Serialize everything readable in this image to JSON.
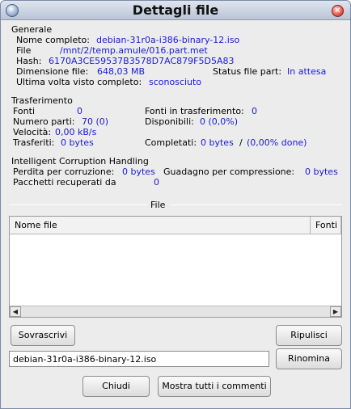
{
  "window": {
    "title": "Dettagli file"
  },
  "general": {
    "heading": "Generale",
    "full_name_label": "Nome completo:",
    "full_name_value": "debian-31r0a-i386-binary-12.iso",
    "file_label": "File",
    "file_value": "/mnt/2/temp.amule/016.part.met",
    "hash_label": "Hash:",
    "hash_value": "6170A3CE59537B3578D7AC879F5D5A83",
    "size_label": "Dimensione file:",
    "size_value": "648,03 MB",
    "status_label": "Status file part:",
    "status_value": "In attesa",
    "last_seen_label": "Ultima volta visto completo:",
    "last_seen_value": "sconosciuto"
  },
  "transfer": {
    "heading": "Trasferimento",
    "sources_label": "Fonti",
    "sources_value": "0",
    "sources_transferring_label": "Fonti in trasferimento:",
    "sources_transferring_value": "0",
    "parts_label": "Numero parti:",
    "parts_value": "70 (0)",
    "available_label": "Disponibili:",
    "available_value": "0 (0,0%)",
    "speed_label": "Velocità:",
    "speed_value": "0,00 kB/s",
    "transferred_label": "Trasferiti:",
    "transferred_value": "0 bytes",
    "completed_label": "Completati:",
    "completed_value": "0 bytes",
    "completed_sep": "/",
    "completed_pct": "(0,00% done)"
  },
  "ich": {
    "heading": "Intelligent Corruption Handling",
    "lost_label": "Perdita per corruzione:",
    "lost_value": "0 bytes",
    "gain_label": "Guadagno per compressione:",
    "gain_value": "0 bytes",
    "recovered_label": "Pacchetti recuperati da",
    "recovered_value": "0"
  },
  "files_section": {
    "heading": "File",
    "columns": [
      "Nome file",
      "Fonti"
    ]
  },
  "buttons": {
    "overwrite": "Sovrascrivi",
    "clean": "Ripulisci",
    "rename": "Rinomina",
    "close": "Chiudi",
    "show_comments": "Mostra tutti i commenti"
  },
  "rename_input": {
    "value": "debian-31r0a-i386-binary-12.iso"
  },
  "colors": {
    "value_text": "#1a1ad8",
    "titlebar": "#c8d1e0"
  }
}
